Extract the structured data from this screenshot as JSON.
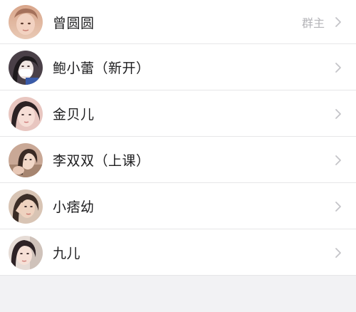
{
  "colors": {
    "background": "#f2f2f4",
    "row_background": "#ffffff",
    "separator": "#e6e6e8",
    "name_text": "#1d1d1f",
    "badge_text": "#b4b4b8",
    "chevron": "#c4c4c8"
  },
  "members": [
    {
      "name": "曾圆圆",
      "badge": "群主",
      "avatar": "avatar-photo"
    },
    {
      "name": "鲍小蕾（新开）",
      "badge": "",
      "avatar": "avatar-photo"
    },
    {
      "name": "金贝儿",
      "badge": "",
      "avatar": "avatar-photo"
    },
    {
      "name": "李双双（上课）",
      "badge": "",
      "avatar": "avatar-photo"
    },
    {
      "name": "小痞幼",
      "badge": "",
      "avatar": "avatar-photo"
    },
    {
      "name": "九儿",
      "badge": "",
      "avatar": "avatar-photo"
    }
  ],
  "icons": {
    "chevron": "chevron-right-icon"
  }
}
